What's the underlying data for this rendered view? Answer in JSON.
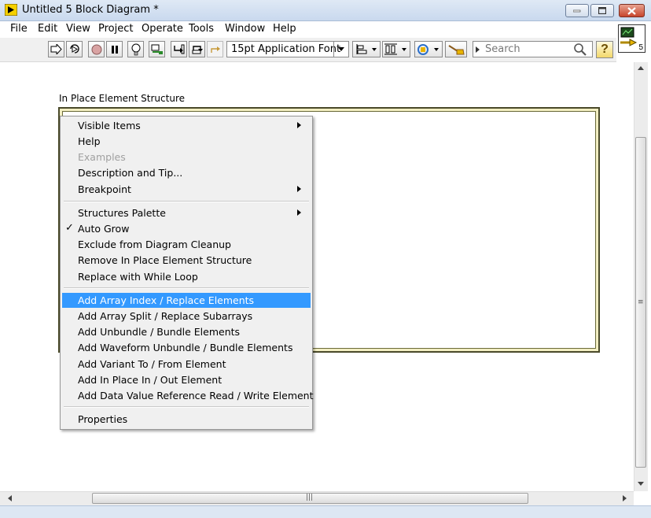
{
  "window": {
    "title": "Untitled 5 Block Diagram *"
  },
  "menubar": {
    "items": [
      "File",
      "Edit",
      "View",
      "Project",
      "Operate",
      "Tools",
      "Window",
      "Help"
    ]
  },
  "toolbar": {
    "font": "15pt Application Font",
    "search_placeholder": "Search",
    "vi_icon_number": "5"
  },
  "diagram": {
    "structure_label": "In Place Element Structure"
  },
  "context_menu": {
    "items": [
      {
        "label": "Visible Items",
        "submenu": true
      },
      {
        "label": "Help"
      },
      {
        "label": "Examples",
        "disabled": true
      },
      {
        "label": "Description and Tip..."
      },
      {
        "label": "Breakpoint",
        "submenu": true
      },
      {
        "label": "Structures Palette",
        "submenu": true
      },
      {
        "label": "Auto Grow",
        "checked": true
      },
      {
        "label": "Exclude from Diagram Cleanup"
      },
      {
        "label": "Remove In Place Element Structure"
      },
      {
        "label": "Replace with While Loop"
      },
      {
        "label": "Add Array Index / Replace Elements",
        "highlighted": true
      },
      {
        "label": "Add Array Split / Replace Subarrays"
      },
      {
        "label": "Add Unbundle / Bundle Elements"
      },
      {
        "label": "Add Waveform Unbundle / Bundle Elements"
      },
      {
        "label": "Add Variant To / From Element"
      },
      {
        "label": "Add In Place In / Out Element"
      },
      {
        "label": "Add Data Value Reference Read / Write Element"
      },
      {
        "label": "Properties"
      }
    ]
  },
  "colors": {
    "highlight": "#3399ff",
    "structure_border": "#4a4a2a",
    "structure_fill": "#f2eec2"
  }
}
